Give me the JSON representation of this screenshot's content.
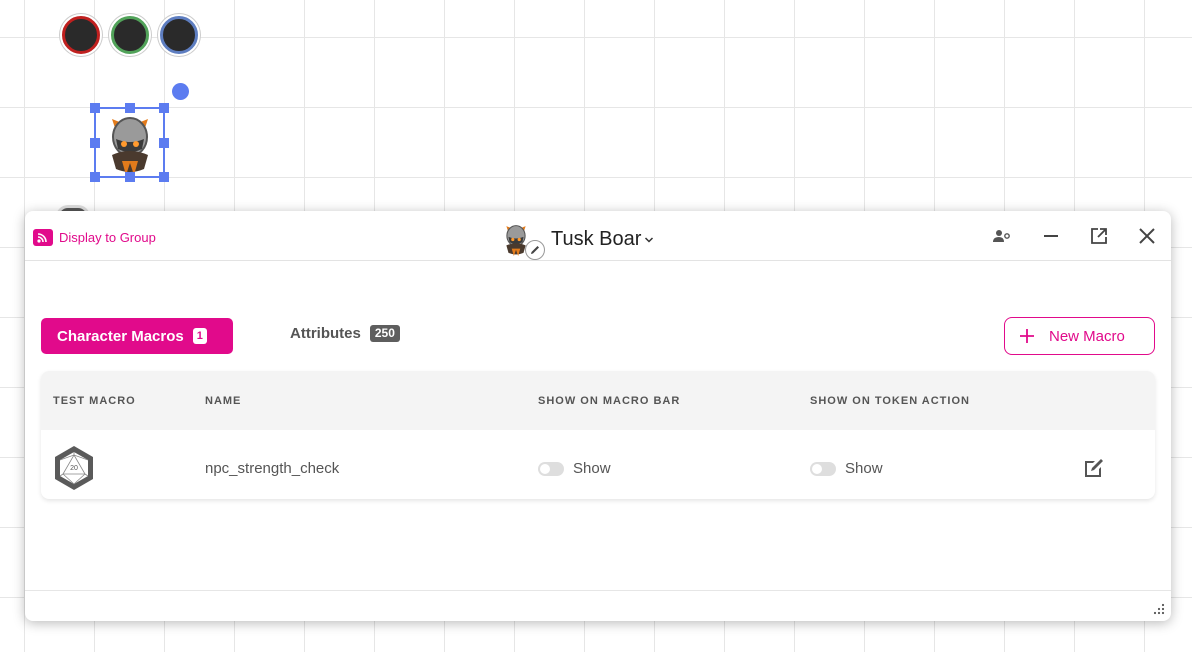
{
  "canvas": {
    "status_colors": [
      "#c0201f",
      "#52a35a",
      "#5e7ec1"
    ],
    "selection_color": "#5c7cf0"
  },
  "dialog": {
    "display_to_group": "Display to Group",
    "character_name": "Tusk Boar",
    "header_icons": [
      "user-settings-icon",
      "minimize-icon",
      "popout-icon",
      "close-icon"
    ],
    "tabs": [
      {
        "label": "Character Macros",
        "count": "1",
        "active": true
      },
      {
        "label": "Attributes",
        "count": "250",
        "active": false
      }
    ],
    "new_macro_label": "New Macro",
    "table": {
      "headers": [
        "TEST MACRO",
        "NAME",
        "SHOW ON MACRO BAR",
        "SHOW ON TOKEN ACTION"
      ],
      "rows": [
        {
          "test_icon": "d20-icon",
          "name": "npc_strength_check",
          "macro_bar": "Show",
          "token_action": "Show",
          "edit_icon": "edit-icon"
        }
      ]
    },
    "accent_color": "#e10a8b"
  }
}
